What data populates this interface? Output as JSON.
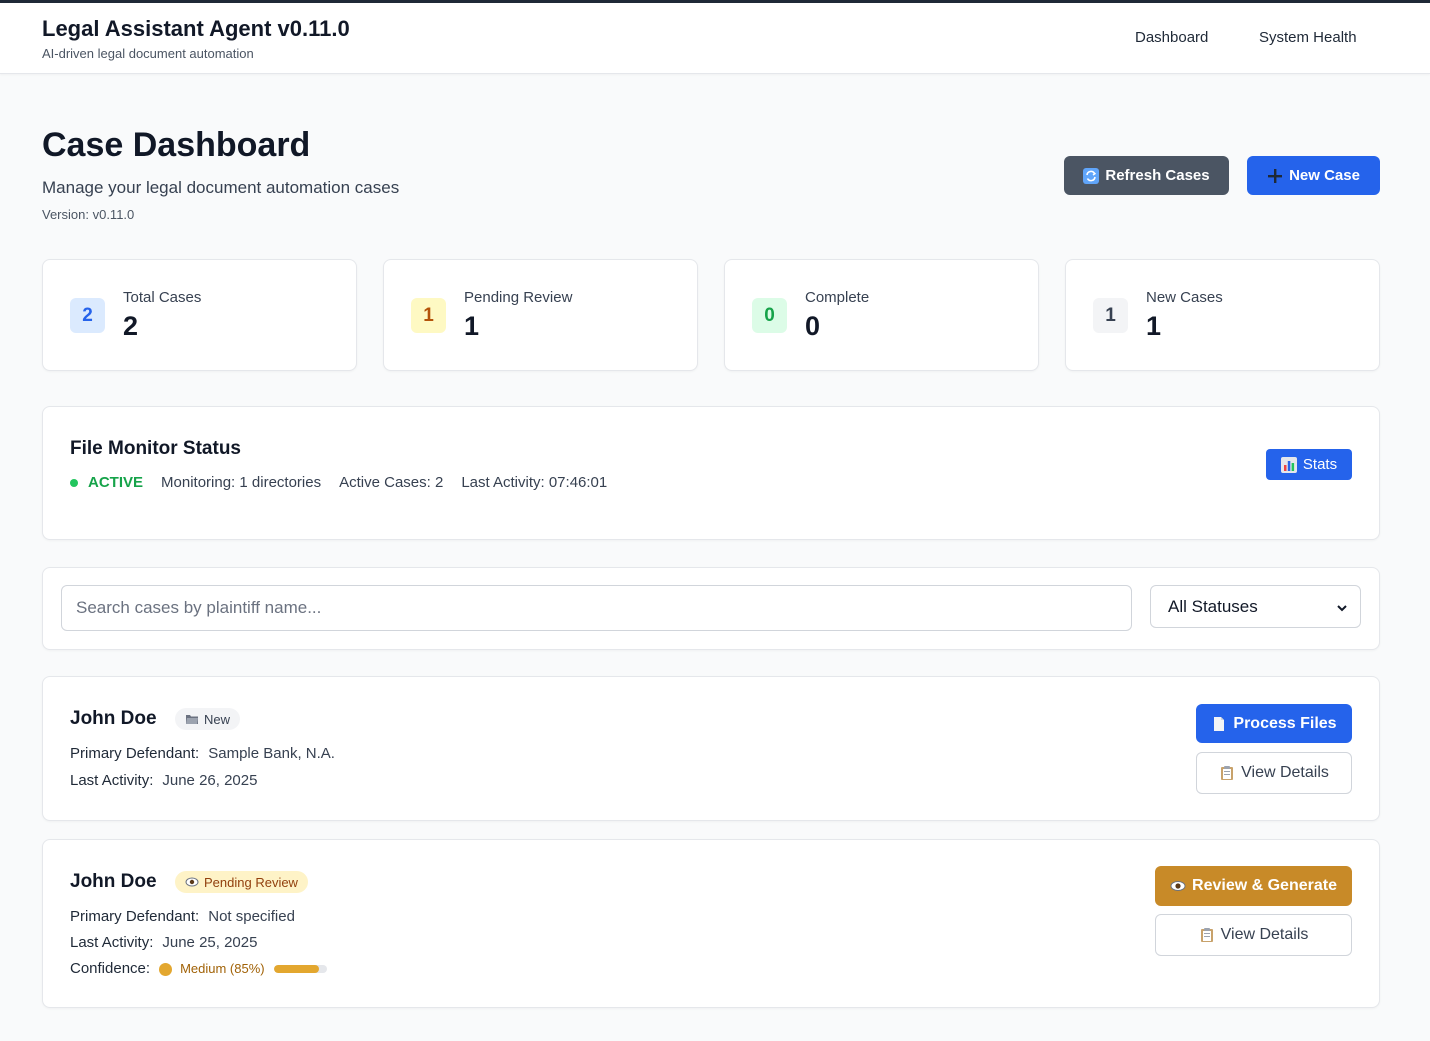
{
  "header": {
    "title": "Legal Assistant Agent v0.11.0",
    "subtitle": "AI-driven legal document automation",
    "nav": [
      "Dashboard",
      "System Health"
    ]
  },
  "page": {
    "title": "Case Dashboard",
    "subtitle": "Manage your legal document automation cases",
    "version": "Version: v0.11.0",
    "refresh_label": "Refresh Cases",
    "new_case_label": "New Case"
  },
  "stats": [
    {
      "badge": "2",
      "label": "Total Cases",
      "value": "2",
      "bg": "#dbeafe",
      "fg": "#2563eb"
    },
    {
      "badge": "1",
      "label": "Pending Review",
      "value": "1",
      "bg": "#fef9c3",
      "fg": "#b45309"
    },
    {
      "badge": "0",
      "label": "Complete",
      "value": "0",
      "bg": "#dcfce7",
      "fg": "#16a34a"
    },
    {
      "badge": "1",
      "label": "New Cases",
      "value": "1",
      "bg": "#f3f4f6",
      "fg": "#374151"
    }
  ],
  "file_monitor": {
    "title": "File Monitor Status",
    "status": "ACTIVE",
    "monitoring": "Monitoring: 1 directories",
    "active_cases": "Active Cases: 2",
    "last_activity": "Last Activity: 07:46:01",
    "stats_label": "Stats"
  },
  "filters": {
    "search_placeholder": "Search cases by plaintiff name...",
    "status_selected": "All Statuses"
  },
  "cases": [
    {
      "name": "John Doe",
      "status": "New",
      "defendant_label": "Primary Defendant:",
      "defendant": "Sample Bank, N.A.",
      "activity_label": "Last Activity:",
      "activity": "June 26, 2025",
      "primary_action": "Process Files",
      "secondary_action": "View Details"
    },
    {
      "name": "John Doe",
      "status": "Pending Review",
      "defendant_label": "Primary Defendant:",
      "defendant": "Not specified",
      "activity_label": "Last Activity:",
      "activity": "June 25, 2025",
      "confidence_label": "Confidence:",
      "confidence_text": "Medium (85%)",
      "confidence_value": 0.85,
      "primary_action": "Review & Generate",
      "secondary_action": "View Details"
    }
  ]
}
